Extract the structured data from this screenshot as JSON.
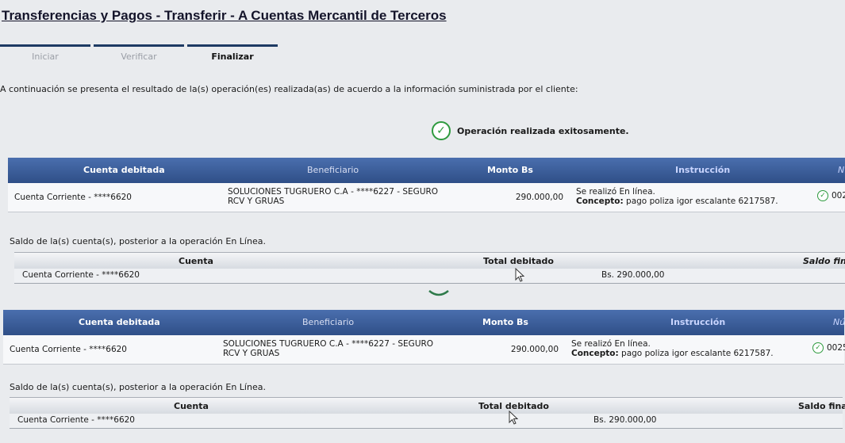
{
  "page": {
    "title": "Transferencias y Pagos - Transferir - A Cuentas Mercantil de Terceros",
    "intro": "A continuación se presenta el resultado de la(s) operación(es) realizada(as) de acuerdo a la información suministrada por el cliente:",
    "success_message": "Operación realizada exitosamente."
  },
  "steps": [
    {
      "label": "Iniciar",
      "state": "done"
    },
    {
      "label": "Verificar",
      "state": "done"
    },
    {
      "label": "Finalizar",
      "state": "active"
    }
  ],
  "operation_headers": {
    "cuenta": "Cuenta debitada",
    "beneficiario": "Beneficiario",
    "monto": "Monto Bs",
    "instruccion": "Instrucción",
    "numero_a": "N",
    "numero_b": "Nú"
  },
  "operations": [
    {
      "cuenta": "Cuenta Corriente - ****6620",
      "beneficiario_1": "SOLUCIONES TUGRUERO C.A - ****6227 - SEGURO",
      "beneficiario_2": "RCV Y GRUAS",
      "monto": "290.000,00",
      "instruccion_1": "Se realizó En línea.",
      "concepto_label": "Concepto:",
      "concepto": " pago poliza igor escalante 6217587.",
      "referencia": "002"
    },
    {
      "cuenta": "Cuenta Corriente - ****6620",
      "beneficiario_1": "SOLUCIONES TUGRUERO C.A - ****6227 - SEGURO",
      "beneficiario_2": "RCV Y GRUAS",
      "monto": "290.000,00",
      "instruccion_1": "Se realizó En línea.",
      "concepto_label": "Concepto:",
      "concepto": " pago poliza igor escalante 6217587.",
      "referencia": "0025"
    }
  ],
  "saldo_label": "Saldo de la(s) cuenta(s), posterior a la operación En Línea.",
  "balance_headers": {
    "cuenta": "Cuenta",
    "total": "Total debitado",
    "saldo_final": "Saldo final"
  },
  "balances": [
    {
      "cuenta": "Cuenta Corriente - ****6620",
      "total": "Bs. 290.000,00"
    },
    {
      "cuenta": "Cuenta Corriente - ****6620",
      "total": "Bs. 290.000,00"
    }
  ],
  "colors": {
    "header_blue": "#2f4f87",
    "success_green": "#2e9a3e",
    "step_bar": "#1d3a63"
  }
}
